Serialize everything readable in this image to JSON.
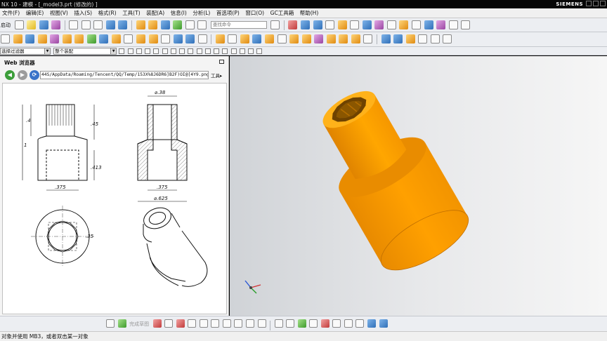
{
  "window": {
    "title": "NX 10 - 建模 - [_model3.prt  (修改的) ]",
    "brand": "SIEMENS"
  },
  "menu": [
    "文件(F)",
    "编辑(E)",
    "视图(V)",
    "插入(S)",
    "格式(R)",
    "工具(T)",
    "装配(A)",
    "信息(I)",
    "分析(L)",
    "首选项(P)",
    "窗口(O)",
    "GC工具箱",
    "帮助(H)"
  ],
  "toolbar": {
    "start_label": "启动",
    "command_search_placeholder": "查找命令"
  },
  "selection_bar": {
    "filter_value": "选择过滤器",
    "scope_value": "整个装配"
  },
  "web_browser": {
    "title": "Web 浏览器",
    "url": "44S/AppData/Roaming/Tencent/QQ/Temp/153X%8J6DR6]B2F)OI@[4Y9.png",
    "tools_label": "工具"
  },
  "drawing": {
    "dims": {
      "top_dia": "⌀.38",
      "height_4": ".4",
      "height_45": ".45",
      "total_1": "1",
      "height_413": ".413",
      "width_375_left": ".375",
      "width_375_right": ".375",
      "dia_625": "⌀.625",
      "hex_35": ".35"
    }
  },
  "sketch_bar": {
    "finish_label": "完成草图"
  },
  "status": {
    "message": "对象并使用 MB3，或者双击某一对象"
  },
  "colors": {
    "part_orange": "#FFA000",
    "part_shadow": "#D57E00",
    "viewport_left": "#D0D3D7",
    "viewport_right": "#F6F6F6"
  },
  "icons": [
    "start-icon",
    "new-icon",
    "open-icon",
    "save-icon",
    "cut-icon",
    "copy-icon",
    "paste-icon",
    "undo-icon",
    "redo-icon",
    "search-icon",
    "sketch-icon",
    "extrude-icon",
    "revolve-icon",
    "hole-icon",
    "blend-icon",
    "chamfer-icon",
    "shell-icon",
    "measure-icon",
    "view-icon",
    "render-icon",
    "triad-icon"
  ]
}
